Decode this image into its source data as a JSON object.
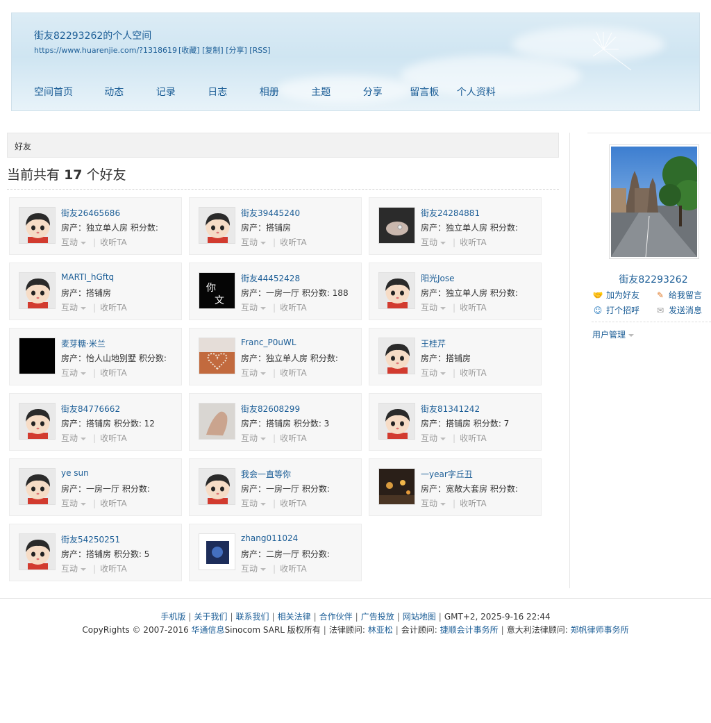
{
  "header": {
    "title": "街友82293262的个人空间",
    "url": "https://www.huarenjie.com/?1318619",
    "url_links": [
      "[收藏]",
      "[复制]",
      "[分享]",
      "[RSS]"
    ],
    "nav": [
      "空间首页",
      "动态",
      "记录",
      "日志",
      "相册",
      "主题",
      "分享",
      "留言板",
      "个人资料"
    ]
  },
  "main": {
    "breadcrumb": "好友",
    "count_prefix": "当前共有",
    "count": "17",
    "count_suffix": "个好友",
    "action_interact": "互动",
    "action_follow": "收听TA",
    "friends": [
      {
        "name": "街友26465686",
        "info": "房产：独立单人房   积分数:",
        "avatar": "cartoon"
      },
      {
        "name": "街友39445240",
        "info": "房产：搭铺房",
        "avatar": "cartoon"
      },
      {
        "name": "街友24284881",
        "info": "房产：独立单人房   积分数:",
        "avatar": "hands"
      },
      {
        "name": "MARTI_hGftq",
        "info": "房产：搭铺房",
        "avatar": "cartoon"
      },
      {
        "name": "街友44452428",
        "info": "房产：一房一厅   积分数: 188",
        "avatar": "black-text"
      },
      {
        "name": "阳光Jose",
        "info": "房产：独立单人房   积分数:",
        "avatar": "cartoon"
      },
      {
        "name": "麦芽糖·米兰",
        "info": "房产：怡人山地别墅   积分数:",
        "avatar": "black"
      },
      {
        "name": "Franc_P0uWL",
        "info": "房产：独立单人房   积分数:",
        "avatar": "heart"
      },
      {
        "name": "王桂芹",
        "info": "房产：搭铺房",
        "avatar": "cartoon"
      },
      {
        "name": "街友84776662",
        "info": "房产：搭铺房   积分数: 12",
        "avatar": "cartoon"
      },
      {
        "name": "街友82608299",
        "info": "房产：搭铺房   积分数: 3",
        "avatar": "hand"
      },
      {
        "name": "街友81341242",
        "info": "房产：搭铺房   积分数: 7",
        "avatar": "cartoon"
      },
      {
        "name": "ye sun",
        "info": "房产：一房一厅   积分数:",
        "avatar": "cartoon"
      },
      {
        "name": "我会一直等你",
        "info": "房产：一房一厅   积分数:",
        "avatar": "cartoon"
      },
      {
        "name": "一year字丘丑",
        "info": "房产：宽敞大套房   积分数:",
        "avatar": "night"
      },
      {
        "name": "街友54250251",
        "info": "房产：搭铺房   积分数: 5",
        "avatar": "cartoon"
      },
      {
        "name": "zhang011024",
        "info": "房产：二房一厅   积分数:",
        "avatar": "blue"
      }
    ]
  },
  "sidebar": {
    "profile_name": "街友82293262",
    "add_friend": "加为好友",
    "leave_message": "给我留言",
    "say_hello": "打个招呼",
    "send_message": "发送消息",
    "user_manage": "用户管理"
  },
  "footer": {
    "links": [
      "手机版",
      "关于我们",
      "联系我们",
      "相关法律",
      "合作伙伴",
      "广告投放",
      "网站地图"
    ],
    "timezone": "GMT+2, 2025-9-16 22:44",
    "copyright_prefix": "CopyRights © 2007-2016",
    "company": "华通信息",
    "company_rest": "Sinocom SARL 版权所有",
    "legal_label": "法律顾问:",
    "legal_name": "林亚松",
    "accountant_label": "会计顾问:",
    "accountant_name": "捷顺会计事务所",
    "italy_label": "意大利法律顾问:",
    "italy_name": "郑帆律师事务所"
  }
}
